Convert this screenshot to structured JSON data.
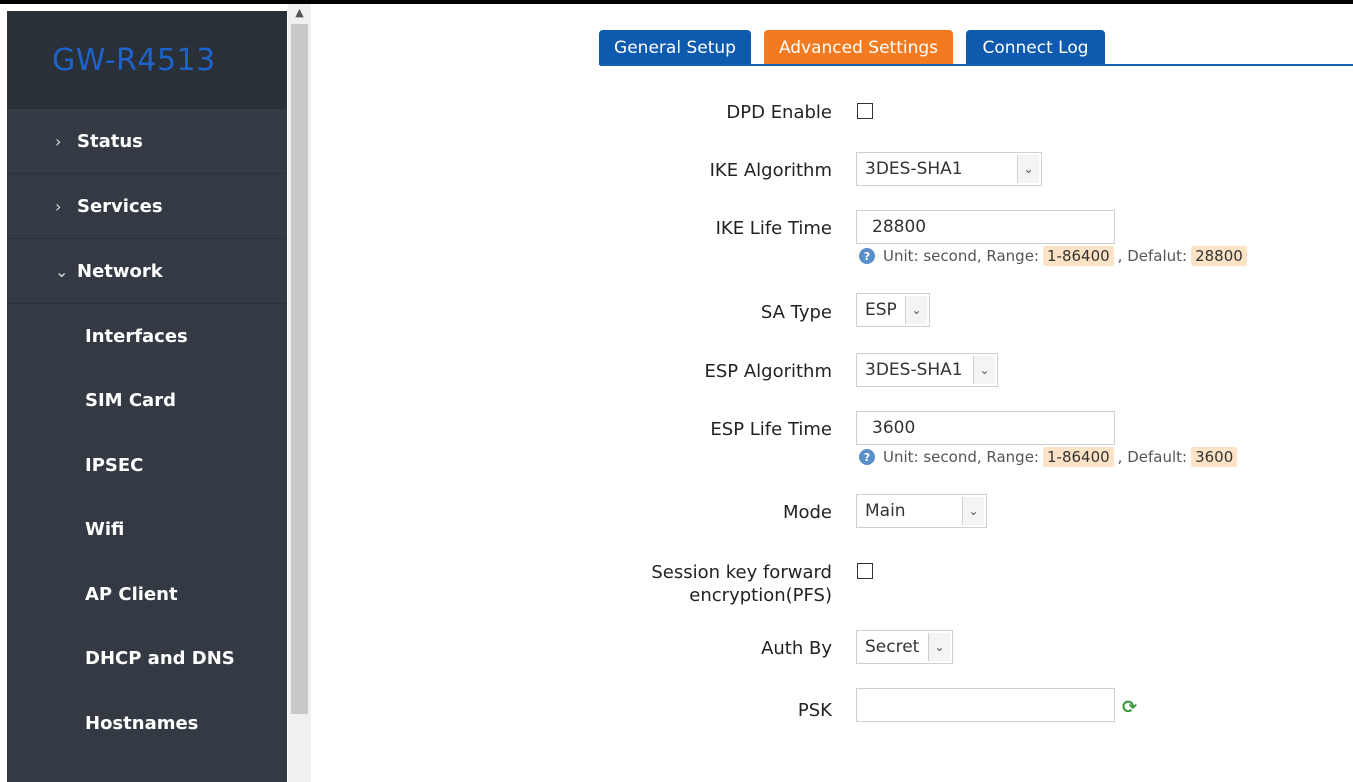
{
  "app": {
    "title": "GW-R4513"
  },
  "sidebar": {
    "menu": [
      {
        "label": "Status",
        "icon": "chevron-right-icon"
      },
      {
        "label": "Services",
        "icon": "chevron-right-icon"
      },
      {
        "label": "Network",
        "icon": "chevron-down-icon"
      }
    ],
    "network_items": [
      "Interfaces",
      "SIM Card",
      "IPSEC",
      "Wifi",
      "AP Client",
      "DHCP and DNS",
      "Hostnames"
    ]
  },
  "tabs": {
    "general": "General Setup",
    "advanced": "Advanced Settings",
    "log": "Connect Log",
    "active": "Advanced Settings"
  },
  "form": {
    "dpd_enable": {
      "label": "DPD Enable",
      "checked": false
    },
    "ike_algorithm": {
      "label": "IKE Algorithm",
      "value": "3DES-SHA1"
    },
    "ike_life_time": {
      "label": "IKE Life Time",
      "value": "28800",
      "hint_prefix": "Unit: second, Range:",
      "range": "1-86400",
      "default_label": ", Defalut:",
      "default": "28800"
    },
    "sa_type": {
      "label": "SA Type",
      "value": "ESP"
    },
    "esp_algorithm": {
      "label": "ESP Algorithm",
      "value": "3DES-SHA1"
    },
    "esp_life_time": {
      "label": "ESP Life Time",
      "value": "3600",
      "hint_prefix": "Unit: second, Range:",
      "range": "1-86400",
      "default_label": ", Default:",
      "default": "3600"
    },
    "mode": {
      "label": "Mode",
      "value": "Main"
    },
    "pfs": {
      "label_line1": "Session key forward",
      "label_line2": "encryption(PFS)",
      "checked": false
    },
    "auth_by": {
      "label": "Auth By",
      "value": "Secret"
    },
    "psk": {
      "label": "PSK",
      "value": ""
    }
  },
  "colors": {
    "sidebar_bg": "#333a43",
    "brand_text": "#1e63c9",
    "tab_blue": "#0d5aae",
    "tab_orange": "#f47a1f",
    "hint_tag_bg": "#fde3c6"
  }
}
